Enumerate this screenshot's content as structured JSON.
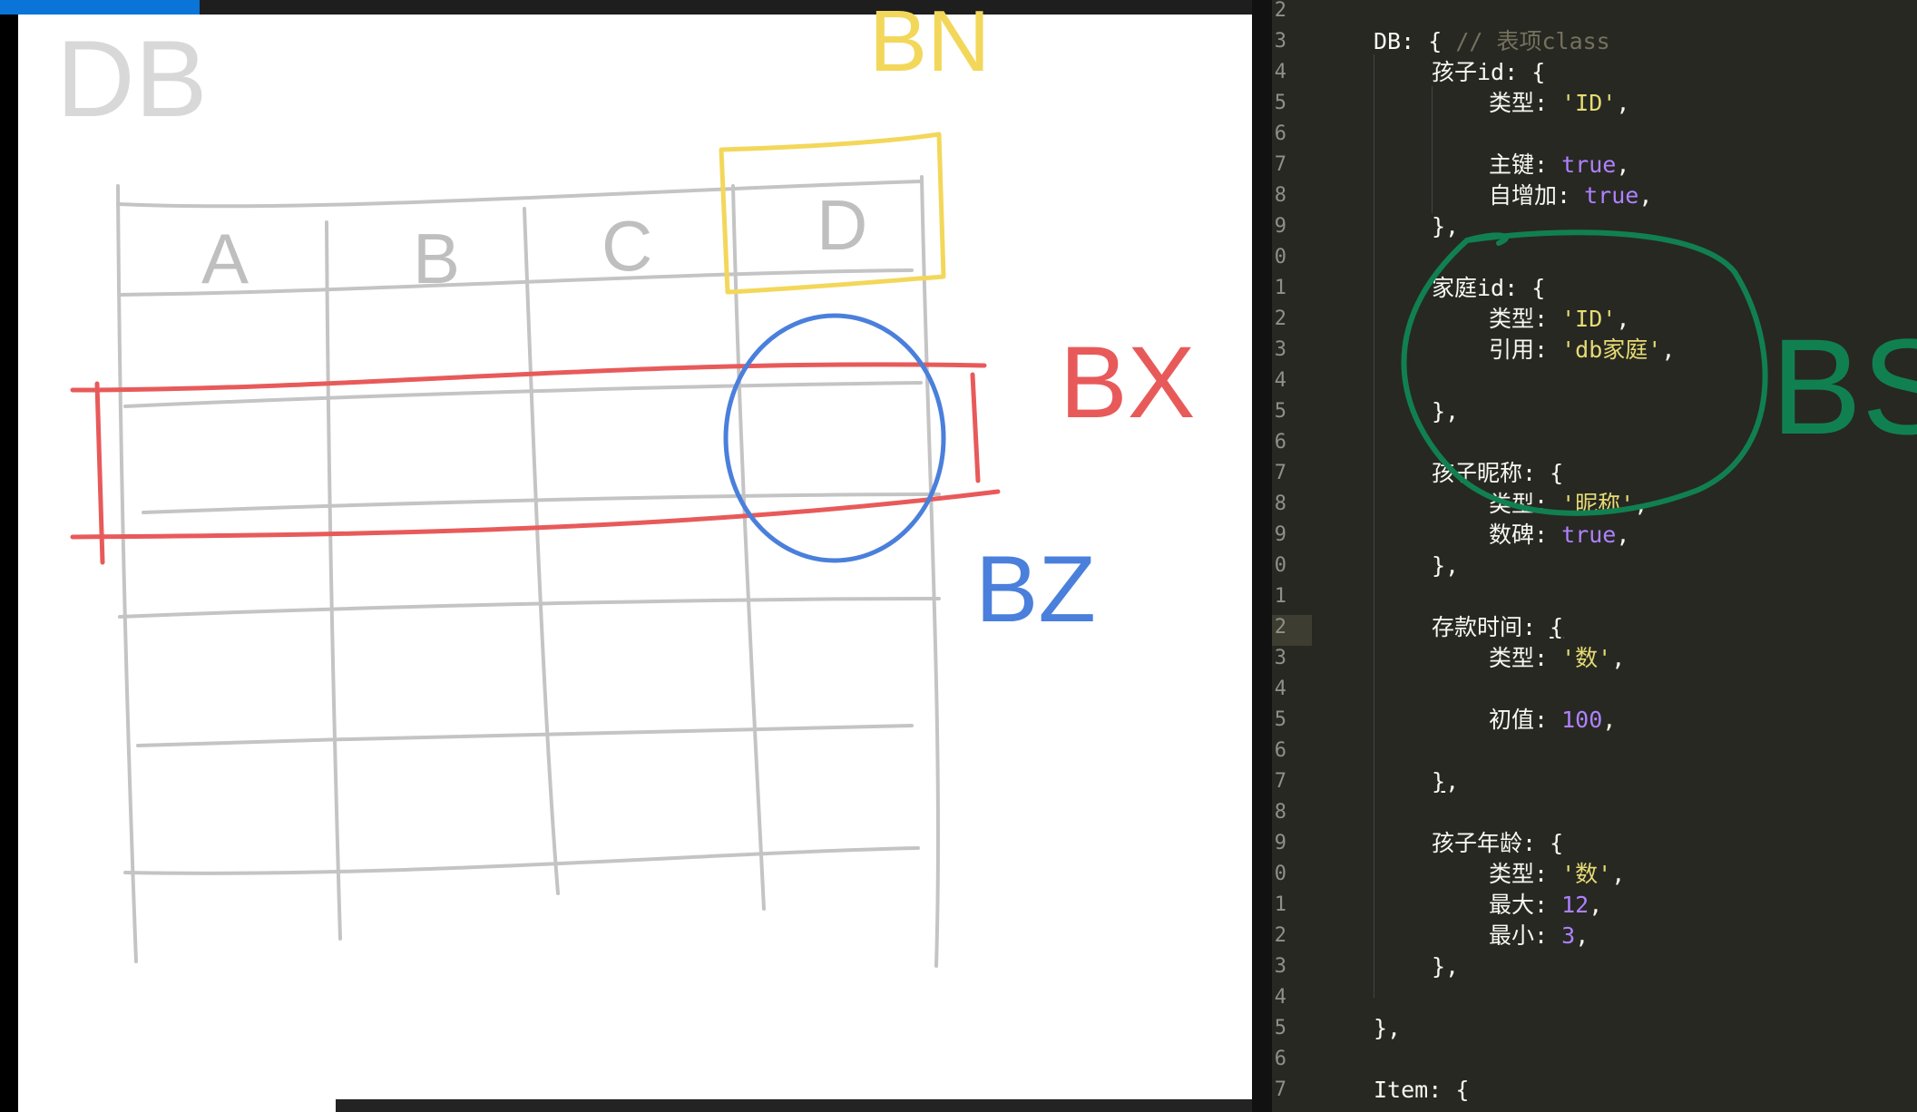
{
  "drawing": {
    "labels": {
      "db": "DB",
      "bn": "BN",
      "bx": "BX",
      "bz": "BZ",
      "bs": "BS",
      "col_a": "A",
      "col_b": "B",
      "col_c": "C",
      "col_d": "D"
    },
    "colors": {
      "pencil": "#c4c4c4",
      "label_gray": "#d8d8d8",
      "yellow": "#f3d75a",
      "red": "#e85a5a",
      "blue": "#4a7fdc",
      "green": "#118051"
    }
  },
  "editor": {
    "line_numbers": [
      "2",
      "3",
      "4",
      "5",
      "6",
      "7",
      "8",
      "9",
      "0",
      "1",
      "2",
      "3",
      "4",
      "5",
      "6",
      "7",
      "8",
      "9",
      "0",
      "1",
      "2",
      "3",
      "4",
      "5",
      "6",
      "7",
      "8",
      "9",
      "0",
      "1",
      "2",
      "3",
      "4",
      "5",
      "6",
      "7"
    ],
    "code": {
      "db_name": "DB",
      "db_comment": "// 表项class",
      "child_id_key": "孩子id",
      "child_id_type_key": "类型",
      "child_id_type_val": "'ID'",
      "primary_key": "主键",
      "primary_val": "true",
      "autoinc_key": "自增加",
      "autoinc_val": "true",
      "family_id_key": "家庭id",
      "family_type_key": "类型",
      "family_type_val": "'ID'",
      "ref_key": "引用",
      "ref_val": "'db家庭'",
      "nick_key": "孩子昵称",
      "nick_type_key": "类型",
      "nick_type_val": "'昵称'",
      "tablet_key": "数碑",
      "tablet_val": "true",
      "deposit_key": "存款时间",
      "deposit_type_key": "类型",
      "deposit_type_val": "'数'",
      "init_key": "初值",
      "init_val": "100",
      "age_key": "孩子年龄",
      "age_type_key": "类型",
      "age_type_val": "'数'",
      "max_key": "最大",
      "max_val": "12",
      "min_key": "最小",
      "min_val": "3",
      "item_name": "Item"
    },
    "colors": {
      "bg": "#272822",
      "text": "#f8f8f2",
      "string": "#e6db74",
      "number": "#ae81ff",
      "comment": "#75715e",
      "gutter": "#8f908a",
      "current_line": "#3e3d32"
    }
  }
}
